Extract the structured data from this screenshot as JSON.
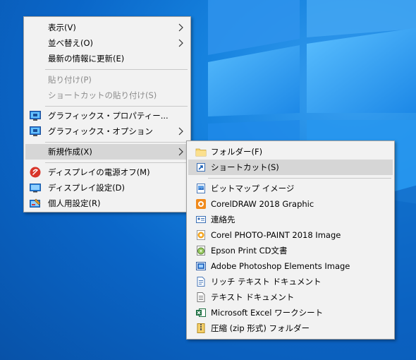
{
  "main_menu": {
    "view": "表示(V)",
    "sort": "並べ替え(O)",
    "refresh": "最新の情報に更新(E)",
    "paste": "貼り付け(P)",
    "paste_shortcut": "ショートカットの貼り付け(S)",
    "graphics_properties": "グラフィックス・プロパティー...",
    "graphics_options": "グラフィックス・オプション",
    "new": "新規作成(X)",
    "display_power_off": "ディスプレイの電源オフ(M)",
    "display_settings": "ディスプレイ設定(D)",
    "personalize": "個人用設定(R)"
  },
  "sub_menu": {
    "folder": "フォルダー(F)",
    "shortcut": "ショートカット(S)",
    "bitmap": "ビットマップ イメージ",
    "coreldraw": "CorelDRAW 2018 Graphic",
    "contact": "連絡先",
    "photopaint": "Corel PHOTO-PAINT 2018 Image",
    "epson": "Epson Print CD文書",
    "photoshop": "Adobe Photoshop Elements Image",
    "rtf": "リッチ テキスト ドキュメント",
    "text": "テキスト ドキュメント",
    "excel": "Microsoft Excel ワークシート",
    "zip": "圧縮 (zip 形式) フォルダー"
  },
  "colors": {
    "menu_bg": "#f2f2f2",
    "highlight": "#d6d6d6",
    "disabled_text": "#8c8c8c",
    "desktop_blue": "#0a66c8"
  }
}
